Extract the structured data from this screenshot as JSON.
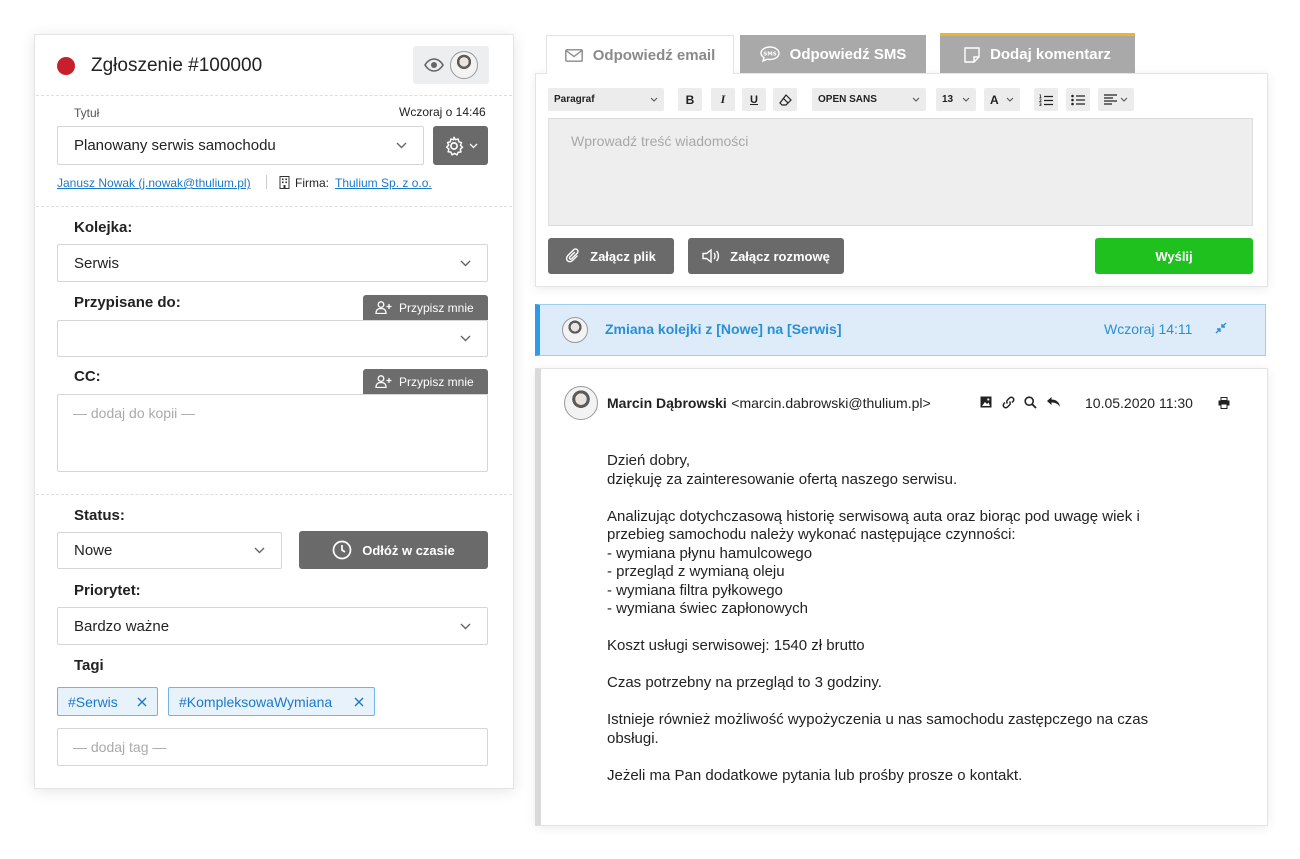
{
  "ticket": {
    "title": "Zgłoszenie #100000",
    "status_color": "#c8202a",
    "watch_icon": "eye-icon",
    "title_label": "Tytuł",
    "timestamp": "Wczoraj o 14:46",
    "subject": "Planowany serwis samochodu",
    "contact_link": "Janusz Nowak (j.nowak@thulium.pl)",
    "company_label": "Firma:",
    "company_link": "Thulium Sp. z o.o.",
    "queue_label": "Kolejka:",
    "queue_value": "Serwis",
    "assigned_label": "Przypisane do:",
    "assigned_value": "",
    "assign_me_label": "Przypisz mnie",
    "cc_label": "CC:",
    "cc_placeholder": "— dodaj do kopii —",
    "status_label": "Status:",
    "status_value": "Nowe",
    "postpone_label": "Odłóż w czasie",
    "priority_label": "Priorytet:",
    "priority_value": "Bardzo ważne",
    "tags_label": "Tagi",
    "tags": [
      "#Serwis",
      "#KompleksowaWymiana"
    ],
    "tag_placeholder": "— dodaj tag —"
  },
  "composer": {
    "tabs": [
      {
        "label": "Odpowiedź email",
        "icon": "envelope-icon",
        "active": true
      },
      {
        "label": "Odpowiedź SMS",
        "icon": "sms-icon",
        "active": false
      },
      {
        "label": "Dodaj komentarz",
        "icon": "note-icon",
        "active": false
      }
    ],
    "comment_tab_accent": "#f0b429",
    "toolbar": {
      "block_format": "Paragraf",
      "bold": "B",
      "italic": "I",
      "underline": "U",
      "font_family": "OPEN SANS",
      "font_size": "13",
      "font_color": "A"
    },
    "placeholder": "Wprowadź treść wiadomości",
    "attach_file": "Załącz plik",
    "attach_call": "Załącz rozmowę",
    "send": "Wyślij",
    "send_color": "#1ec11e"
  },
  "event": {
    "text": "Zmiana kolejki z [Nowe] na [Serwis]",
    "time": "Wczoraj 14:11",
    "accent": "#2e9be8"
  },
  "message": {
    "sender_name": "Marcin Dąbrowski",
    "sender_email": "<marcin.dabrowski@thulium.pl>",
    "date": "10.05.2020 11:30",
    "actions": [
      "image-icon",
      "link-icon",
      "search-icon",
      "reply-icon"
    ],
    "body": [
      "Dzień dobry,",
      "dziękuję za zainteresowanie ofertą naszego serwisu.",
      "",
      "Analizując dotychczasową historię serwisową auta oraz biorąc pod uwagę wiek i",
      "przebieg samochodu należy wykonać następujące czynności:",
      "- wymiana płynu hamulcowego",
      "- przegląd z wymianą oleju",
      "- wymiana filtra pyłkowego",
      "- wymiana świec zapłonowych",
      "",
      "Koszt usługi serwisowej: 1540 zł brutto",
      "",
      "Czas potrzebny na przegląd to 3 godziny.",
      "",
      "Istnieje również możliwość wypożyczenia u nas samochodu zastępczego na czas",
      "obsługi.",
      "",
      "Jeżeli ma Pan dodatkowe pytania lub prośby prosze o kontakt."
    ]
  }
}
